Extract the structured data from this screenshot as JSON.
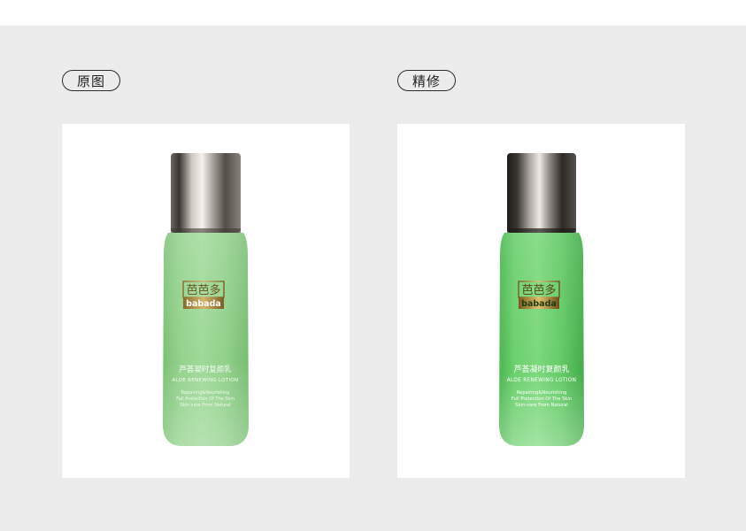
{
  "labels": {
    "left": "原图",
    "right": "精修"
  },
  "product": {
    "brand_cn": "芭芭多",
    "brand_en": "babada",
    "name_cn": "芦荟凝时复颜乳",
    "name_en": "ALOE RENEWING LOTION",
    "tagline": [
      "Repairing&Nourishing",
      "Full Protection Of The Skin",
      "Skin-care From Natural"
    ]
  },
  "colors": {
    "background": "#ececec",
    "card": "#ffffff",
    "original_bottle": "#8fd089",
    "retouched_bottle": "#68cf6a"
  }
}
